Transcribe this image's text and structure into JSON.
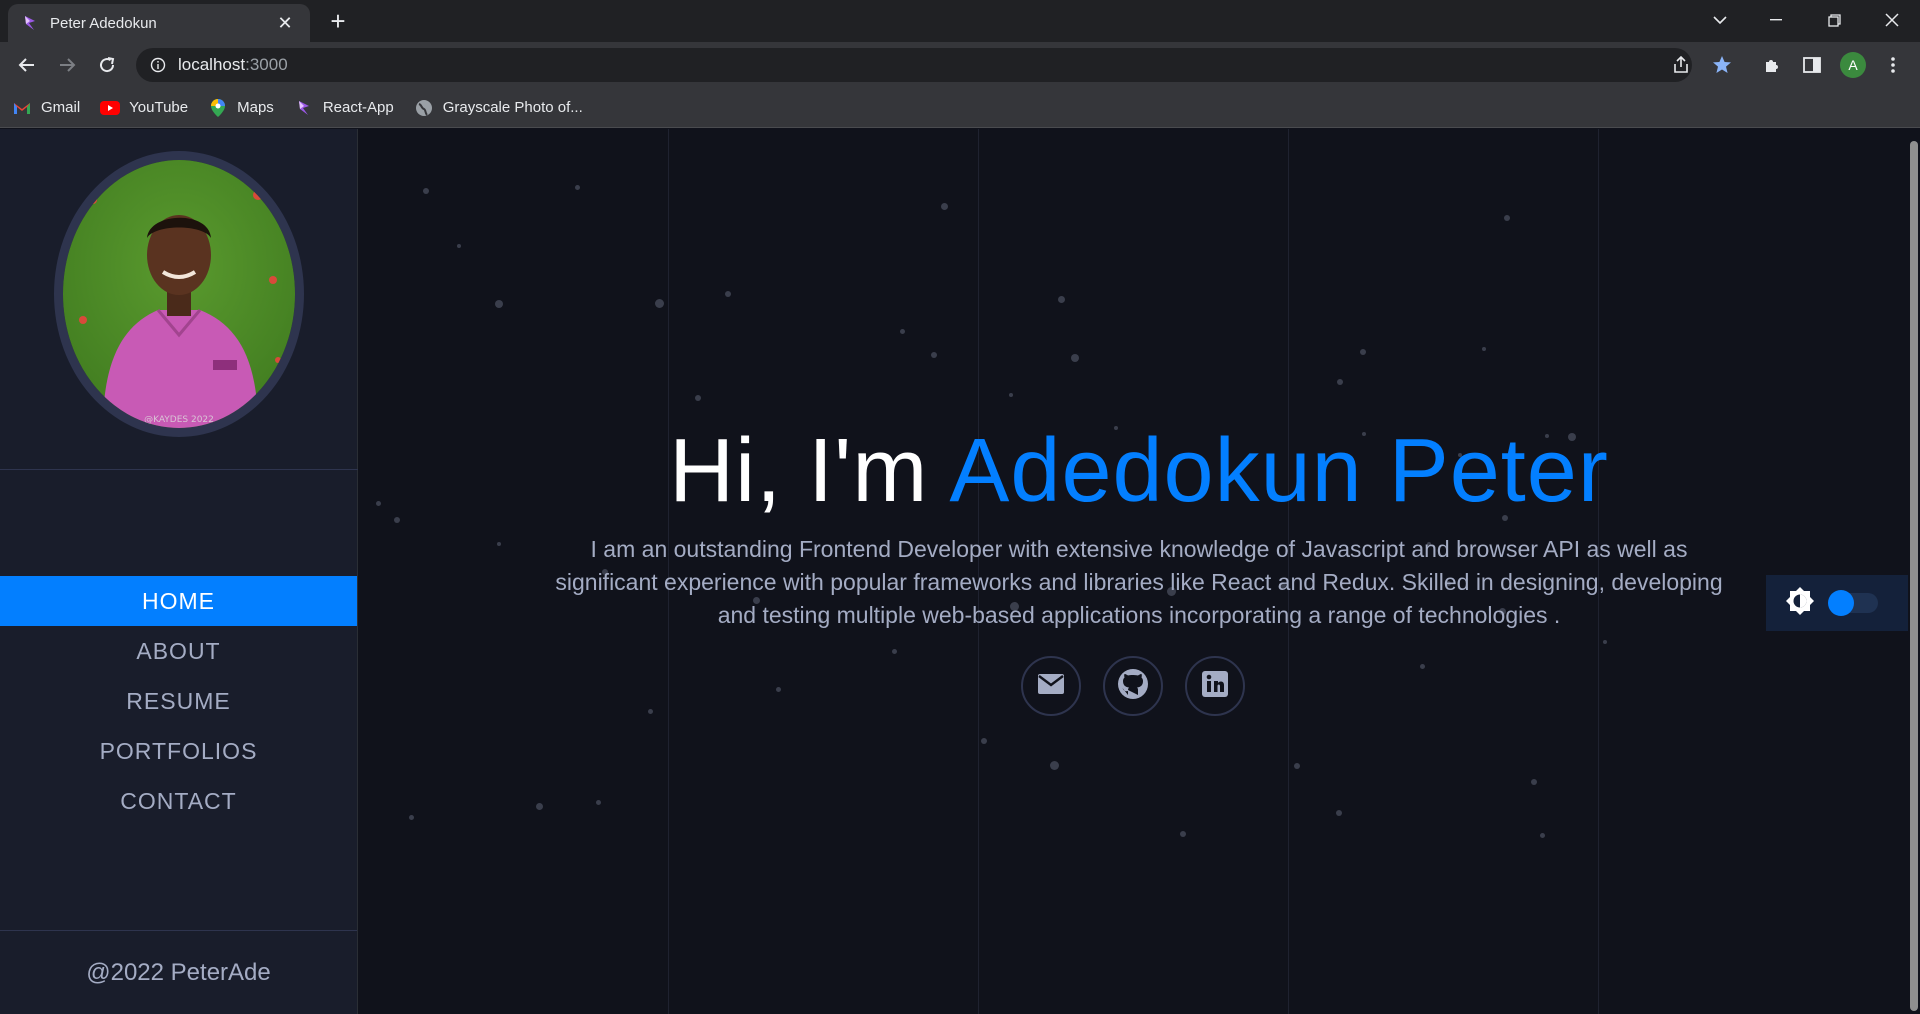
{
  "browser": {
    "tab_title": "Peter Adedokun",
    "url_host": "localhost",
    "url_port": ":3000",
    "profile_initial": "A",
    "bookmarks": [
      {
        "label": "Gmail",
        "icon": "gmail-icon"
      },
      {
        "label": "YouTube",
        "icon": "youtube-icon"
      },
      {
        "label": "Maps",
        "icon": "maps-icon"
      },
      {
        "label": "React-App",
        "icon": "react-app-icon"
      },
      {
        "label": "Grayscale Photo of...",
        "icon": "globe-icon"
      }
    ]
  },
  "sidebar": {
    "photo_caption": "@KAYDES 2022",
    "menu": [
      {
        "label": "HOME",
        "active": true
      },
      {
        "label": "ABOUT",
        "active": false
      },
      {
        "label": "RESUME",
        "active": false
      },
      {
        "label": "PORTFOLIOS",
        "active": false
      },
      {
        "label": "CONTACT",
        "active": false
      }
    ],
    "footer": "@2022 PeterAde"
  },
  "hero": {
    "greeting": "Hi, I'm ",
    "name": "Adedokun Peter",
    "description": "I am an outstanding Frontend Developer with extensive knowledge of Javascript and browser API as well as significant experience with popular frameworks and libraries like React and Redux. Skilled in designing, developing and testing multiple web-based applications incorporating a range of technologies ."
  },
  "socials": [
    "email-icon",
    "github-icon",
    "linkedin-icon"
  ],
  "colors": {
    "accent": "#037fff",
    "sidebar_bg": "#191d2b",
    "page_bg": "#10121b",
    "text_muted": "#a4acc4"
  }
}
